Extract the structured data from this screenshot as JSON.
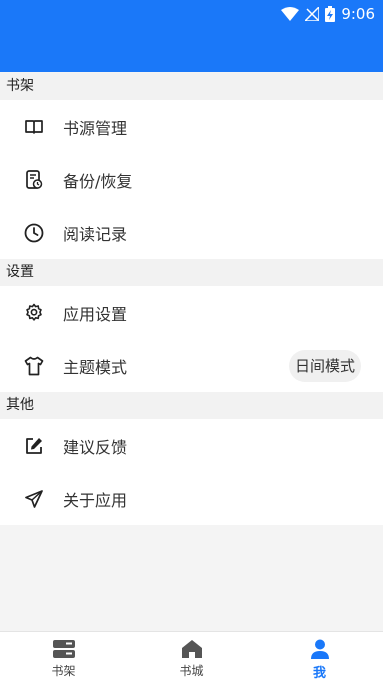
{
  "status_bar": {
    "time": "9:06",
    "icons": [
      "wifi-icon",
      "signal-off-icon",
      "battery-charging-icon"
    ]
  },
  "colors": {
    "primary": "#1a78f9",
    "background": "#f4f4f4",
    "text": "#333333"
  },
  "sections": [
    {
      "header": "书架",
      "items": [
        {
          "label": "书源管理",
          "icon": "book-open-icon"
        },
        {
          "label": "备份/恢复",
          "icon": "backup-restore-icon"
        },
        {
          "label": "阅读记录",
          "icon": "clock-icon"
        }
      ]
    },
    {
      "header": "设置",
      "items": [
        {
          "label": "应用设置",
          "icon": "gear-icon"
        },
        {
          "label": "主题模式",
          "icon": "tshirt-icon",
          "value": "日间模式"
        }
      ]
    },
    {
      "header": "其他",
      "items": [
        {
          "label": "建议反馈",
          "icon": "edit-icon"
        },
        {
          "label": "关于应用",
          "icon": "paper-plane-icon"
        }
      ]
    }
  ],
  "bottom_nav": [
    {
      "label": "书架",
      "icon": "bookshelf-icon",
      "active": false
    },
    {
      "label": "书城",
      "icon": "home-icon",
      "active": false
    },
    {
      "label": "我",
      "icon": "user-icon",
      "active": true
    }
  ]
}
